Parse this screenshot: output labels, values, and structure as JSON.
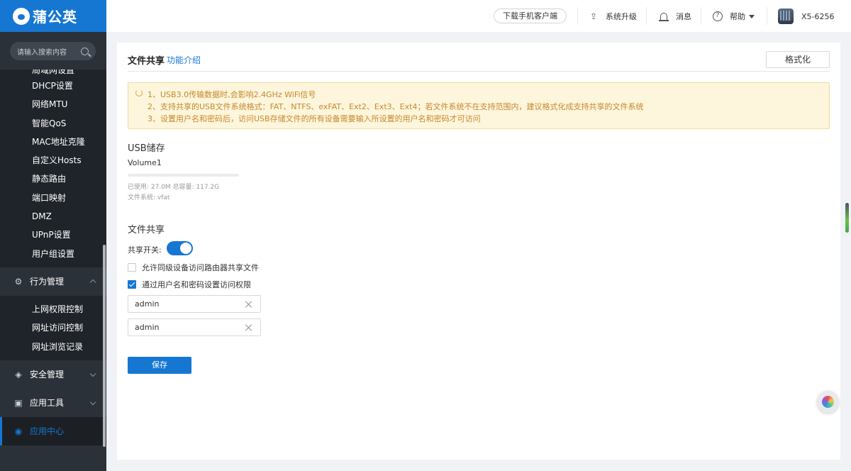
{
  "brand": {
    "name": "蒲公英"
  },
  "sidebar": {
    "search_placeholder": "请输入搜索内容",
    "cut_item": "局域网设置",
    "network_items": [
      "DHCP设置",
      "网络MTU",
      "智能QoS",
      "MAC地址克隆",
      "自定义Hosts",
      "静态路由",
      "端口映射",
      "DMZ",
      "UPnP设置",
      "用户组设置"
    ],
    "groups": {
      "behavior": {
        "label": "行为管理",
        "icon": "gear-icon"
      },
      "security": {
        "label": "安全管理",
        "icon": "shield-icon"
      },
      "tools": {
        "label": "应用工具",
        "icon": "briefcase-icon"
      },
      "center": {
        "label": "应用中心",
        "icon": "app-center-icon"
      }
    },
    "behavior_items": [
      "上网权限控制",
      "网址访问控制",
      "网址浏览记录"
    ]
  },
  "topbar": {
    "download_label": "下载手机客户端",
    "upgrade_label": "系统升级",
    "message_label": "消息",
    "help_label": "帮助",
    "device_name": "X5-6256"
  },
  "page": {
    "title": "文件共享",
    "intro_link": "功能介绍",
    "format_button": "格式化",
    "notices": [
      "1、USB3.0传输数据时,会影响2.4GHz WiFi信号",
      "2、支持共享的USB文件系统格式：FAT、NTFS、exFAT、Ext2、Ext3、Ext4；若文件系统不在支持范围内，建议格式化成支持共享的文件系统",
      "3、设置用户名和密码后，访问USB存储文件的所有设备需要输入所设置的用户名和密码才可访问"
    ],
    "usb": {
      "section_title": "USB储存",
      "volume_name": "Volume1",
      "used_fraction": 0.0002,
      "usage_line": "已使用:   27.0M    总容量:    117.2G",
      "fs_line": "文件系统:    vfat"
    },
    "share": {
      "section_title": "文件共享",
      "switch_label": "共享开关:",
      "switch_on": true,
      "checkbox_peer_label": "允许同级设备访问路由器共享文件",
      "checkbox_auth_label": "通过用户名和密码设置访问权限",
      "username_value": "admin",
      "password_value": "admin"
    },
    "save_button": "保存"
  },
  "colors": {
    "accent": "#1677d2",
    "sidebar_bg": "#2b3138",
    "notice_bg": "#fdf5dc",
    "notice_text": "#c58a2c"
  }
}
